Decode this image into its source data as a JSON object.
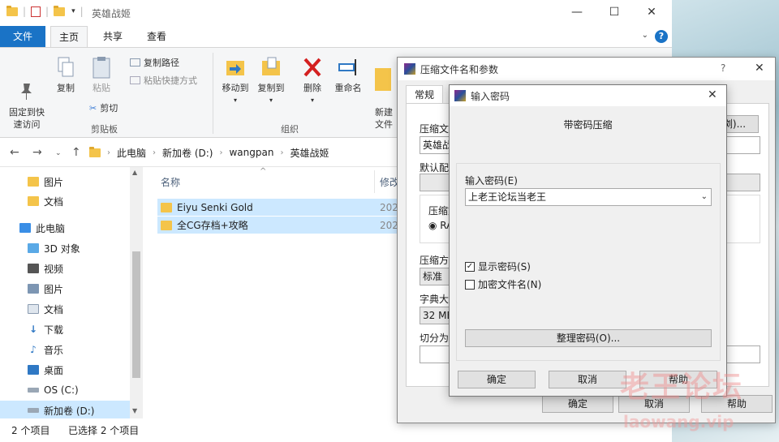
{
  "window": {
    "title": "英雄战姬",
    "controls": {
      "minimize": "—",
      "maximize": "☐",
      "close": "✕"
    }
  },
  "ribbon_tabs": {
    "file": "文件",
    "home": "主页",
    "share": "共享",
    "view": "查看"
  },
  "ribbon": {
    "pin": "固定到快\n速访问",
    "copy": "复制",
    "paste": "粘贴",
    "copy_path": "复制路径",
    "paste_shortcut": "粘贴快捷方式",
    "cut": "剪切",
    "clipboard_group": "剪贴板",
    "move_to": "移动到",
    "copy_to": "复制到",
    "delete": "删除",
    "rename": "重命名",
    "new_folder": "新建\n文件",
    "organize_group": "组织"
  },
  "address": {
    "crumbs": [
      "此电脑",
      "新加卷 (D:)",
      "wangpan",
      "英雄战姬"
    ]
  },
  "nav_pane": {
    "items": [
      {
        "label": "图片",
        "icon": "folder-icon"
      },
      {
        "label": "文档",
        "icon": "folder-icon"
      },
      {
        "label": "此电脑",
        "icon": "computer-icon"
      },
      {
        "label": "3D 对象",
        "icon": "cube-icon"
      },
      {
        "label": "视频",
        "icon": "video-icon"
      },
      {
        "label": "图片",
        "icon": "picture-icon"
      },
      {
        "label": "文档",
        "icon": "document-icon"
      },
      {
        "label": "下载",
        "icon": "download-icon"
      },
      {
        "label": "音乐",
        "icon": "music-icon"
      },
      {
        "label": "桌面",
        "icon": "desktop-icon"
      },
      {
        "label": "OS (C:)",
        "icon": "drive-icon"
      },
      {
        "label": "新加卷 (D:)",
        "icon": "drive-icon"
      }
    ]
  },
  "files": {
    "col_name": "名称",
    "col_date": "修改",
    "rows": [
      {
        "name": "Eiyu Senki Gold",
        "date": "202"
      },
      {
        "name": "全CG存档+攻略",
        "date": "202"
      }
    ]
  },
  "status": {
    "count": "2 个项目",
    "selected": "已选择 2 个项目"
  },
  "archive_dialog": {
    "title": "压缩文件名和参数",
    "help": "?",
    "close": "✕",
    "tab_general": "常规",
    "archive_name_label": "压缩文",
    "archive_name_value": "英雄战",
    "browse": "浏)...",
    "default_profile": "默认配",
    "format_label": "压缩文",
    "format_rar": "RA",
    "method_label": "压缩方",
    "method_value": "标准",
    "dict_label": "字典大",
    "dict_value": "32 MB",
    "split_label": "切分为",
    "ok": "确定",
    "cancel": "取消",
    "help_btn": "帮助"
  },
  "password_dialog": {
    "title": "输入密码",
    "close": "✕",
    "heading": "带密码压缩",
    "password_label": "输入密码(E)",
    "password_value": "上老王论坛当老王",
    "show_password": "显示密码(S)",
    "encrypt_names": "加密文件名(N)",
    "organize": "整理密码(O)...",
    "ok": "确定",
    "cancel": "取消",
    "help": "帮助"
  },
  "watermark": {
    "text": "老王论坛",
    "url": "laowang.vip"
  },
  "colors": {
    "accent": "#1a73c6",
    "selection": "#cce8ff",
    "folder": "#f4c44a"
  }
}
